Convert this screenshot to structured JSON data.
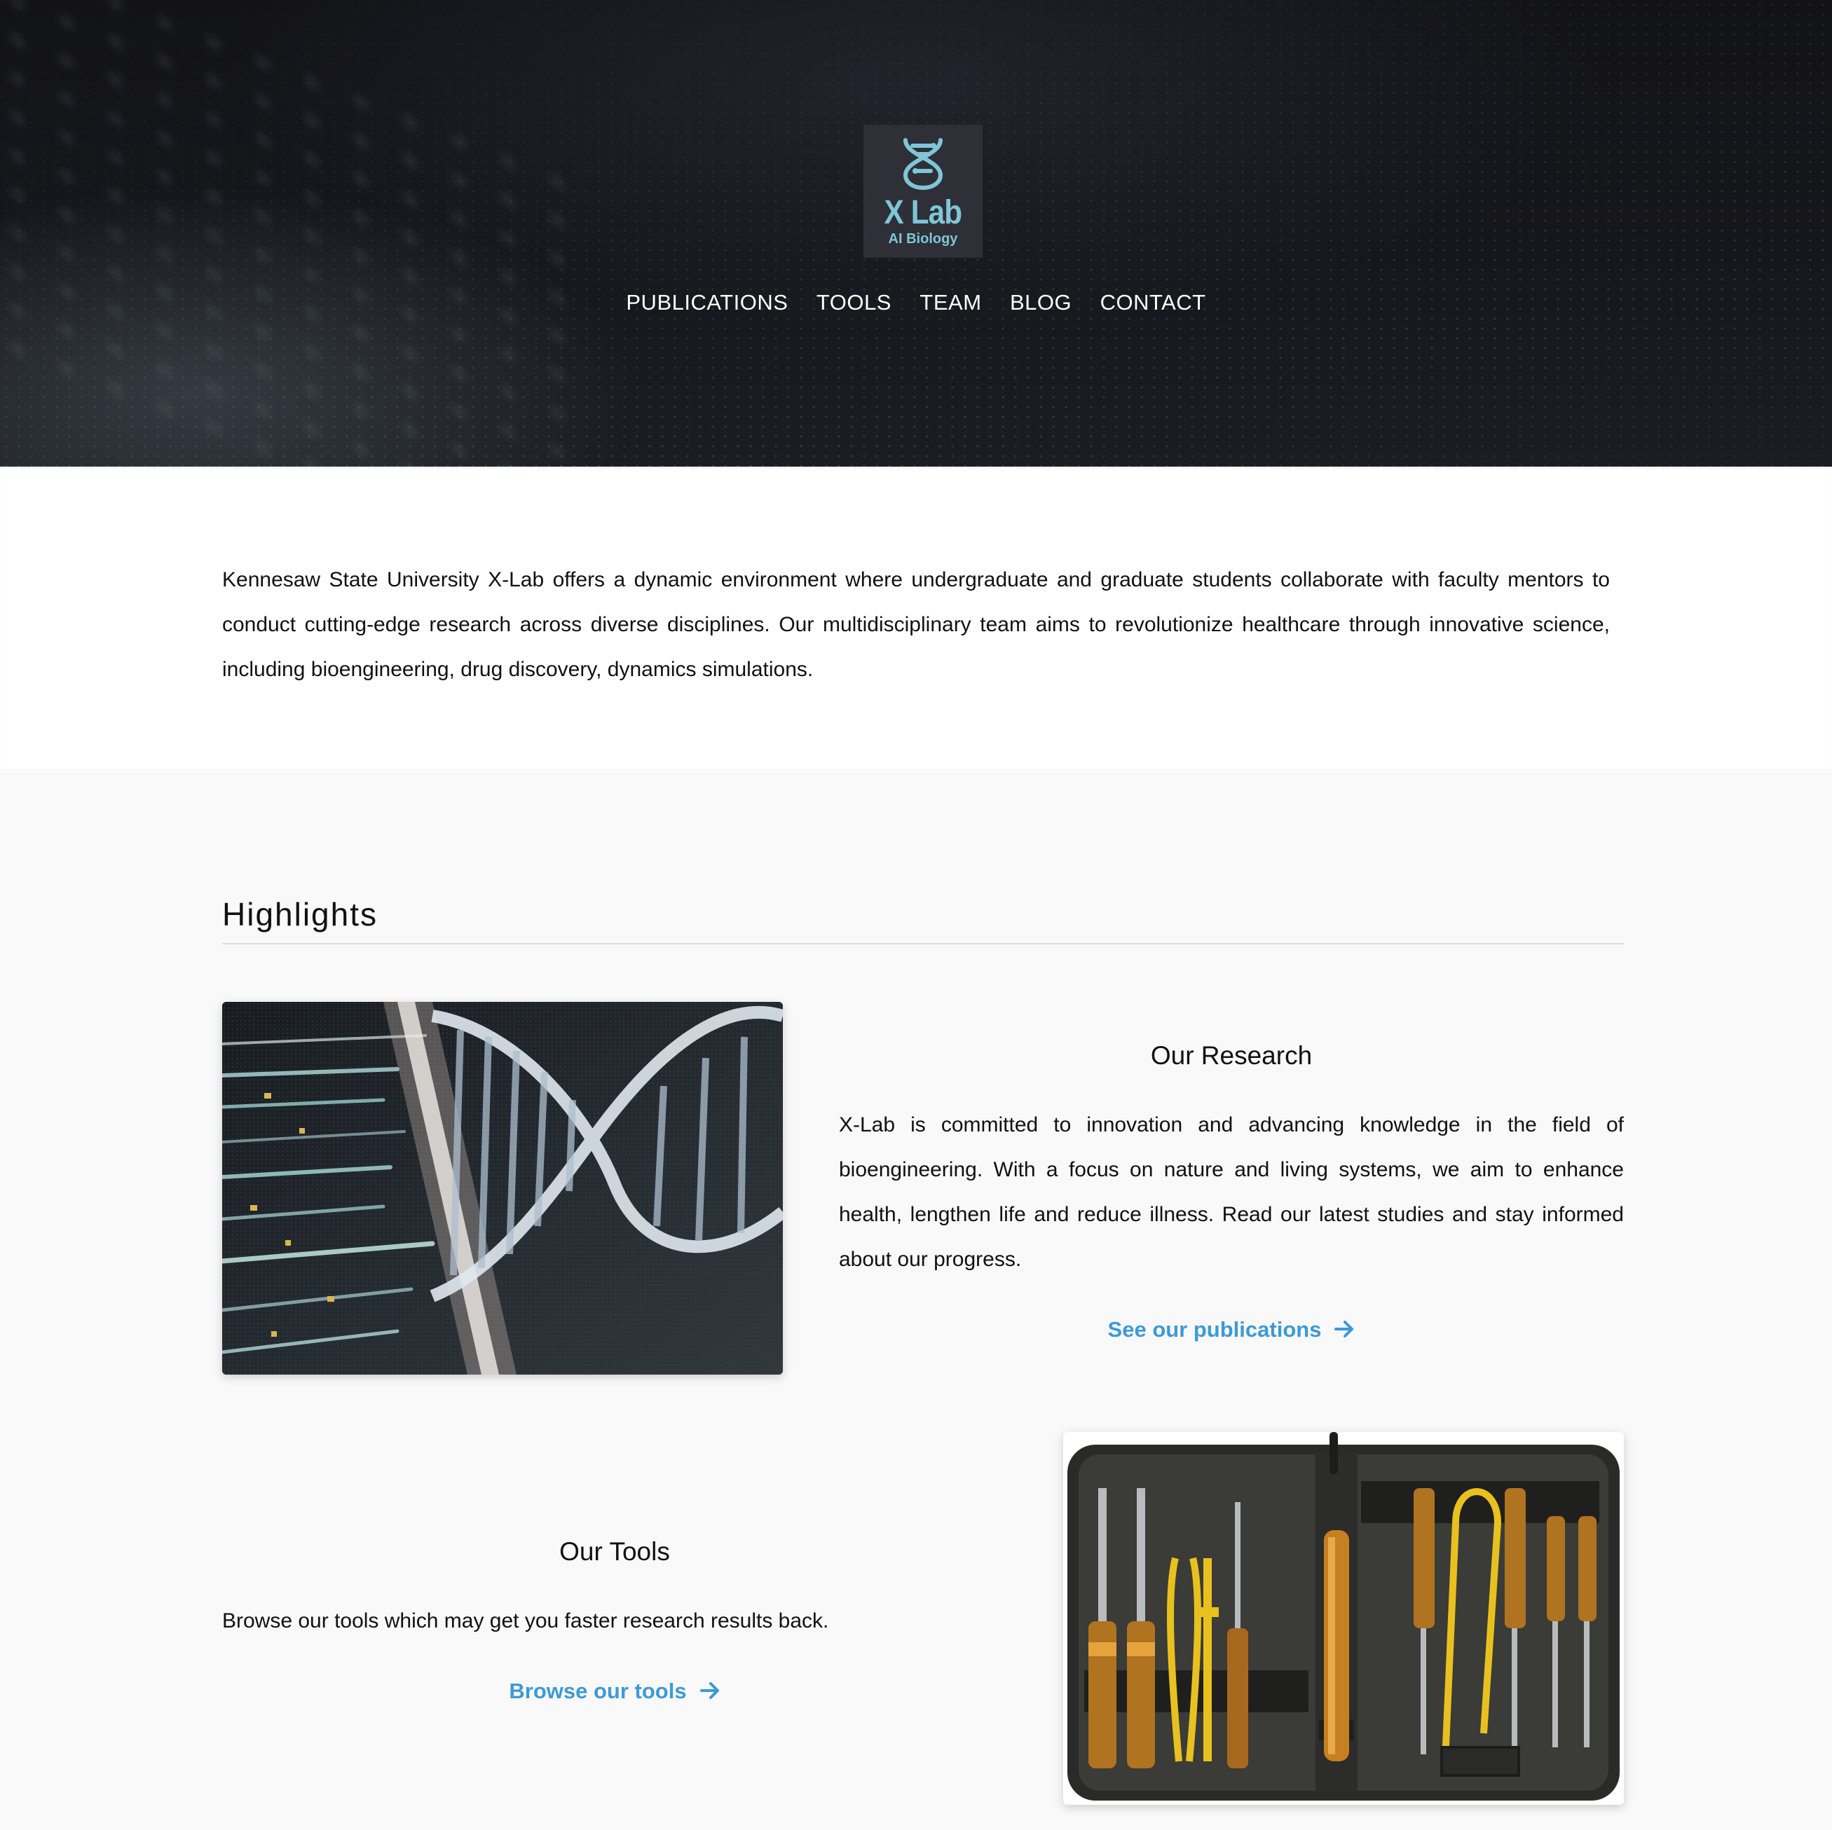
{
  "logo": {
    "title": "X Lab",
    "subtitle": "AI Biology",
    "icon": "dna-helix-icon",
    "accent_color": "#7fc6d6"
  },
  "nav": [
    {
      "label": "PUBLICATIONS"
    },
    {
      "label": "TOOLS"
    },
    {
      "label": "TEAM"
    },
    {
      "label": "BLOG"
    },
    {
      "label": "CONTACT"
    }
  ],
  "intro": {
    "text": "Kennesaw State University X-Lab offers a dynamic environment where undergraduate and graduate students collaborate with faculty mentors to conduct cutting-edge research across diverse disciplines. Our multidisciplinary team aims to revolutionize healthcare through innovative science, including bioengineering, drug discovery, dynamics simulations."
  },
  "highlights": {
    "title": "Highlights",
    "research": {
      "heading": "Our Research",
      "text": "X-Lab is committed to innovation and advancing knowledge in the field of bioengineering. With a focus on nature and living systems, we aim to enhance health, lengthen life and reduce illness. Read our latest studies and stay informed about our progress.",
      "link": "See our publications",
      "image": "dna-helix-image"
    },
    "tools": {
      "heading": "Our Tools",
      "text": "Browse our tools which may get you faster research results back.",
      "link": "Browse our tools",
      "image": "tool-kit-image"
    }
  },
  "colors": {
    "link": "#3d9ad6",
    "hero_bg": "#131317",
    "section_bg": "#f9f9f9"
  }
}
